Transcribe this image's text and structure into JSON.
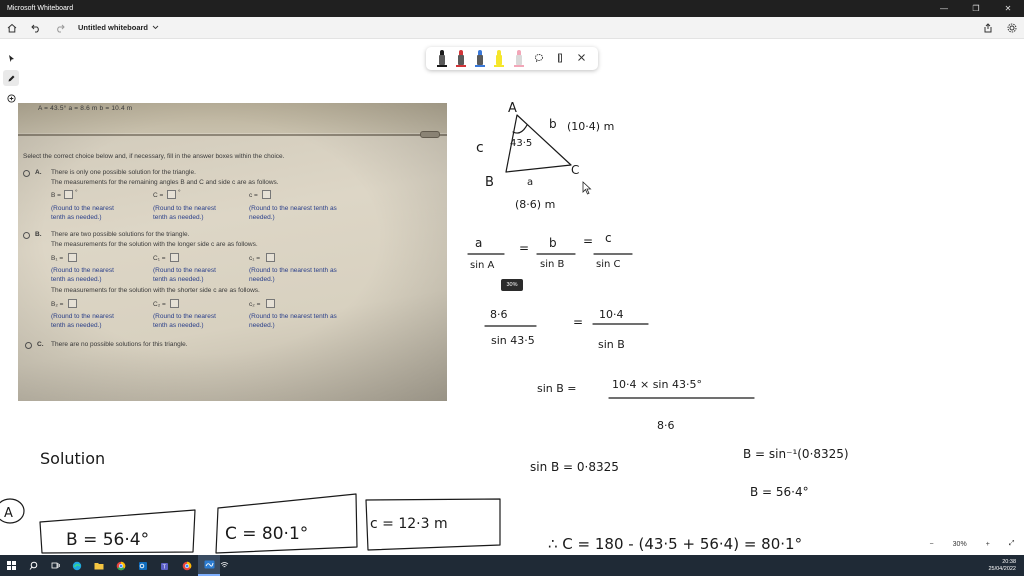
{
  "window": {
    "title": "Microsoft Whiteboard",
    "minimize_glyph": "—",
    "restore_glyph": "❐",
    "close_glyph": "✕"
  },
  "appbar": {
    "document_title": "Untitled whiteboard",
    "icons": [
      "home-icon",
      "undo-icon",
      "redo-icon",
      "share-icon",
      "settings-icon"
    ]
  },
  "pen_tray": {
    "pens": [
      {
        "name": "black-pen",
        "color": "#1a1a1a"
      },
      {
        "name": "red-pen",
        "color": "#d13438"
      },
      {
        "name": "blue-pen",
        "color": "#3a78d8"
      },
      {
        "name": "yellow-highlighter",
        "color": "#f5e62b"
      },
      {
        "name": "pink-highlighter",
        "color": "#f2a6b8"
      }
    ],
    "tools": [
      "lasso-icon",
      "ruler-icon",
      "close-icon"
    ]
  },
  "problem_photo": {
    "given": "A = 43.5°      a = 8.6 m      b = 10.4 m",
    "instruction": "Select the correct choice below and, if necessary, fill in the answer boxes within the choice.",
    "option_a": {
      "letter": "A.",
      "line1": "There is only one possible solution for the triangle.",
      "line2": "The measurements for the remaining angles B and C and side c are as follows.",
      "b_label": "B =",
      "c_angle_label": "C =",
      "c_side_label": "c =",
      "degree": "°",
      "round_tenth": "(Round to the nearest",
      "round_tenth2": "tenth as needed.)",
      "round_tenth_long": "(Round to the nearest tenth as",
      "round_tenth_long2": "needed.)"
    },
    "option_b": {
      "letter": "B.",
      "line1": "There are two possible solutions for the triangle.",
      "line2": "The measurements for the solution with the longer side c are as follows.",
      "b1": "B₁ =",
      "c1_angle": "C₁ =",
      "c1_side": "c₁ =",
      "line3": "The measurements for the solution with the shorter side c are as follows.",
      "b2": "B₂ =",
      "c2_angle": "C₂ =",
      "c2_side": "c₂ ="
    },
    "option_c": {
      "letter": "C.",
      "line1": "There are no possible solutions for this triangle."
    }
  },
  "ink": {
    "vertex_a": "A",
    "vertex_b": "B",
    "vertex_c": "C",
    "side_c": "c",
    "side_b": "b",
    "side_b_len": "(10·4) m",
    "angle_a": "43·5",
    "side_a": "a",
    "side_a_len": "(8·6) m",
    "law_a": "a",
    "law_sina": "sin A",
    "law_b": "b",
    "law_sinb": "sin B",
    "law_c": "c",
    "law_sinc": "sin C",
    "eq1_num": "8·6",
    "eq1_den": "sin 43·5",
    "eq1_rnum": "10·4",
    "eq1_rden": "sin B",
    "eq2_lhs": "sin B  =",
    "eq2_num": "10·4 × sin 43·5°",
    "eq2_den": "8·6",
    "eq3": "sin B  =  0·8325",
    "eq4": "B = sin⁻¹(0·8325)",
    "eq5": "B  = 56·4°",
    "eq6": "∴  C  =  180 - (43·5 + 56·4) = 80·1°",
    "solution": "Solution",
    "part_a": "A",
    "box_b": "B = 56·4°",
    "box_c": "C = 80·1°",
    "box_side_c": "c = 12·3 m",
    "equals": "="
  },
  "zoom_tooltip": "30%",
  "zoom": {
    "out": "−",
    "level": "30%",
    "in": "+",
    "fit": "⤢"
  },
  "taskbar": {
    "time": "20:38",
    "date": "25/04/2022",
    "apps": [
      "windows-start-icon",
      "search-icon",
      "task-view-icon",
      "edge-icon",
      "file-explorer-icon",
      "chrome-icon",
      "outlook-icon",
      "teams-icon",
      "chrome-profile-icon",
      "whiteboard-icon"
    ]
  }
}
